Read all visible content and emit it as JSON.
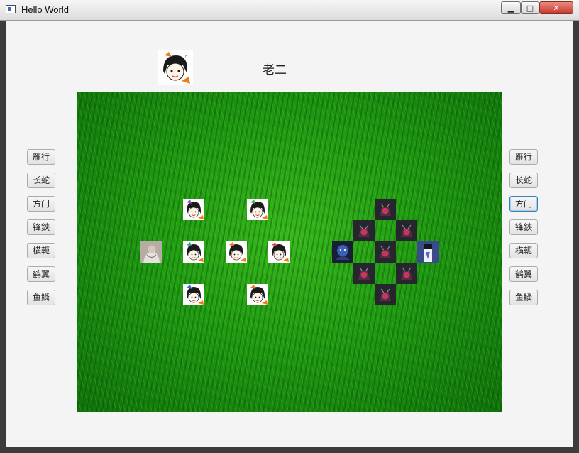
{
  "window": {
    "title": "Hello World"
  },
  "controls": {
    "minimize": "▁",
    "maximize": "□",
    "close": "✕"
  },
  "header": {
    "player_name": "老二",
    "avatar_icon": "cartoon-girl-avatar"
  },
  "left_formations": [
    "雁行",
    "长蛇",
    "方门",
    "锋鋏",
    "横軛",
    "鹤翼",
    "鱼鳞"
  ],
  "right_formations": [
    "雁行",
    "长蛇",
    "方门",
    "锋鋏",
    "横軛",
    "鹤翼",
    "鱼鳞"
  ],
  "right_focused_index": 2,
  "colors": {
    "grass": "#1f9a12",
    "client_bg": "#f4f4f4"
  },
  "battlefield": {
    "left_army": {
      "unit_icon": "cartoon-girl-icon",
      "leader_icon": "elder-portrait-icon"
    },
    "right_army": {
      "unit_icon": "dark-demon-icon",
      "leader_icon": "blue-dragon-icon",
      "end_icon": "blue-warrior-icon"
    }
  }
}
